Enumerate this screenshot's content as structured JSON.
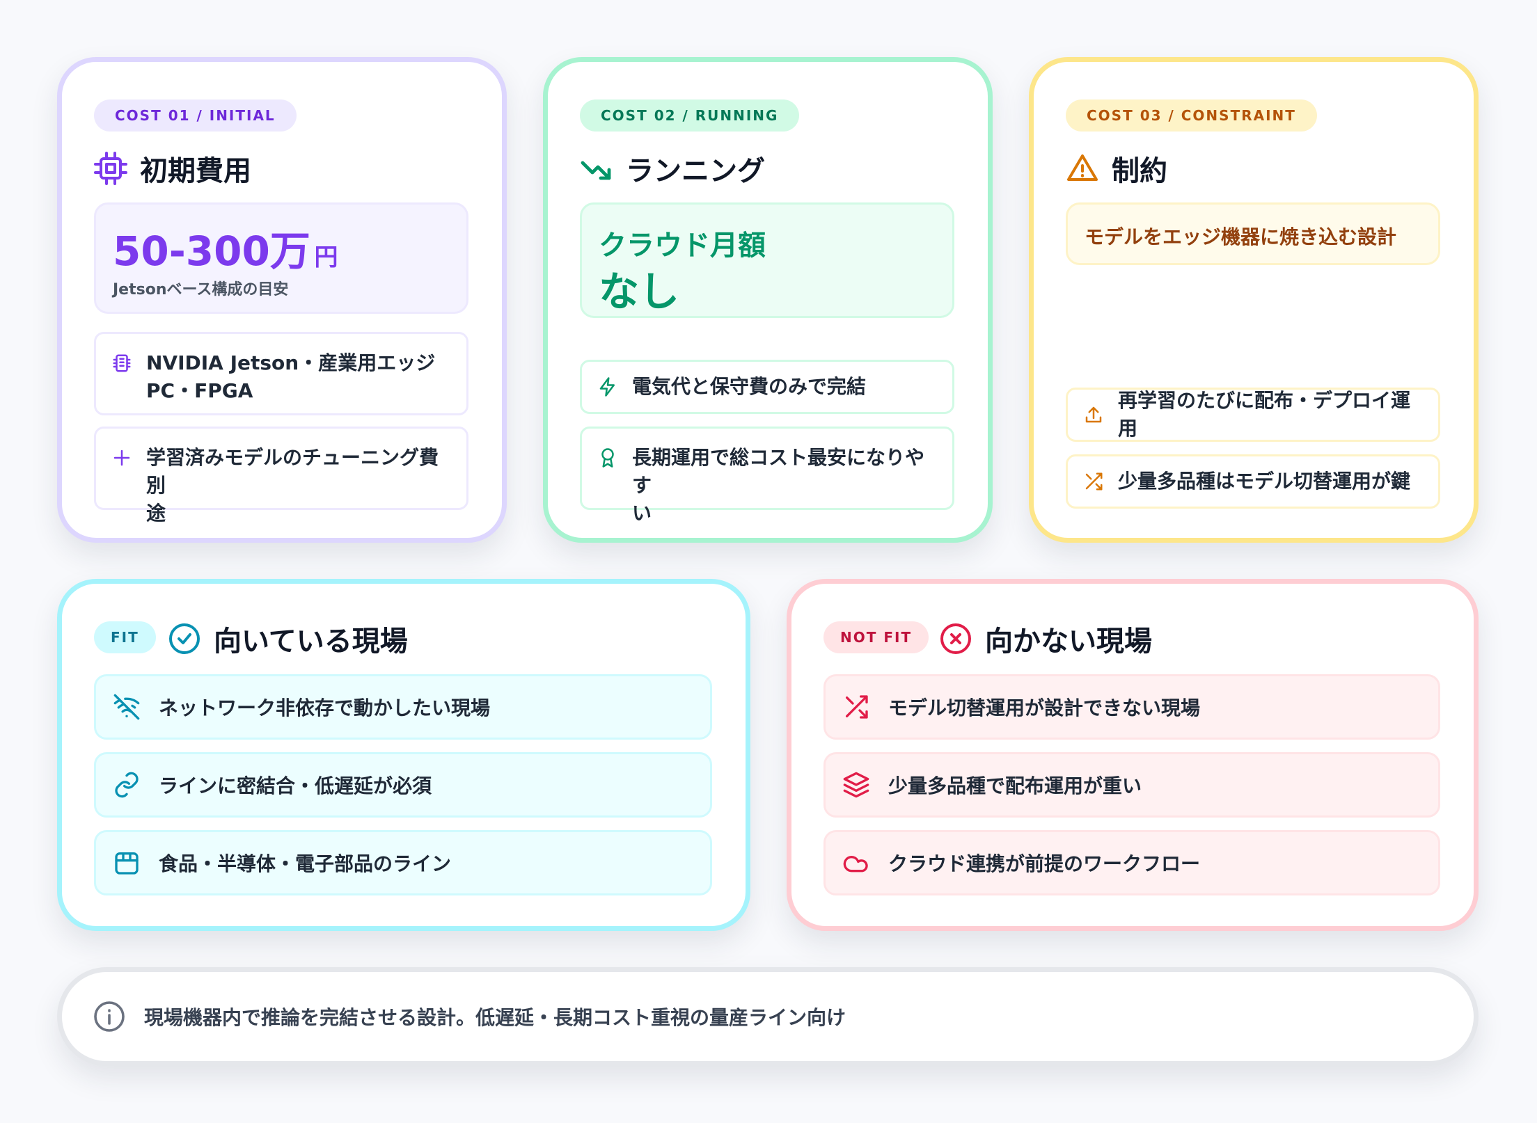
{
  "colors": {
    "purple": "#7c3aed",
    "green": "#059669",
    "yellow": "#d97706",
    "cyan": "#0891b2",
    "red": "#e11d48",
    "gray": "#6b7280"
  },
  "initial": {
    "tag": "COST 01 / INITIAL",
    "icon": "chip-icon",
    "title": "初期費用",
    "price": "50-300万",
    "price_unit": "円",
    "price_note": "Jetsonベース構成の目安",
    "items": [
      {
        "icon": "cpu-icon",
        "line1": "NVIDIA Jetson・産業用エッジ",
        "line2": "PC・FPGA"
      },
      {
        "icon": "plus-icon",
        "line1": "学習済みモデルのチューニング費別",
        "line2": "途"
      }
    ]
  },
  "running": {
    "tag": "COST 02 / RUNNING",
    "icon": "trend-down-icon",
    "title": "ランニング",
    "highlight_line1": "クラウド月額",
    "highlight_line2": "なし",
    "items": [
      {
        "icon": "lightning-icon",
        "line1": "電気代と保守費のみで完結"
      },
      {
        "icon": "award-icon",
        "line1": "長期運用で総コスト最安になりやす",
        "line2": "い"
      }
    ]
  },
  "constraint": {
    "tag": "COST 03 / CONSTRAINT",
    "icon": "warning-icon",
    "title": "制約",
    "highlight": "モデルをエッジ機器に焼き込む設計",
    "items": [
      {
        "icon": "upload-icon",
        "line1": "再学習のたびに配布・デプロイ運用"
      },
      {
        "icon": "shuffle-icon",
        "line1": "少量多品種はモデル切替運用が鍵"
      }
    ]
  },
  "fit": {
    "tag": "FIT",
    "icon": "check-circle-icon",
    "title": "向いている現場",
    "rows": [
      {
        "icon": "wifi-off-icon",
        "label": "ネットワーク非依存で動かしたい現場"
      },
      {
        "icon": "link-icon",
        "label": "ラインに密結合・低遅延が必須"
      },
      {
        "icon": "box-icon",
        "label": "食品・半導体・電子部品のライン"
      }
    ]
  },
  "notfit": {
    "tag": "NOT FIT",
    "icon": "x-circle-icon",
    "title": "向かない現場",
    "rows": [
      {
        "icon": "shuffle-icon",
        "label": "モデル切替運用が設計できない現場"
      },
      {
        "icon": "layers-icon",
        "label": "少量多品種で配布運用が重い"
      },
      {
        "icon": "cloud-icon",
        "label": "クラウド連携が前提のワークフロー"
      }
    ]
  },
  "footer": {
    "icon": "info-icon",
    "text": "現場機器内で推論を完結させる設計。低遅延・長期コスト重視の量産ライン向け"
  }
}
